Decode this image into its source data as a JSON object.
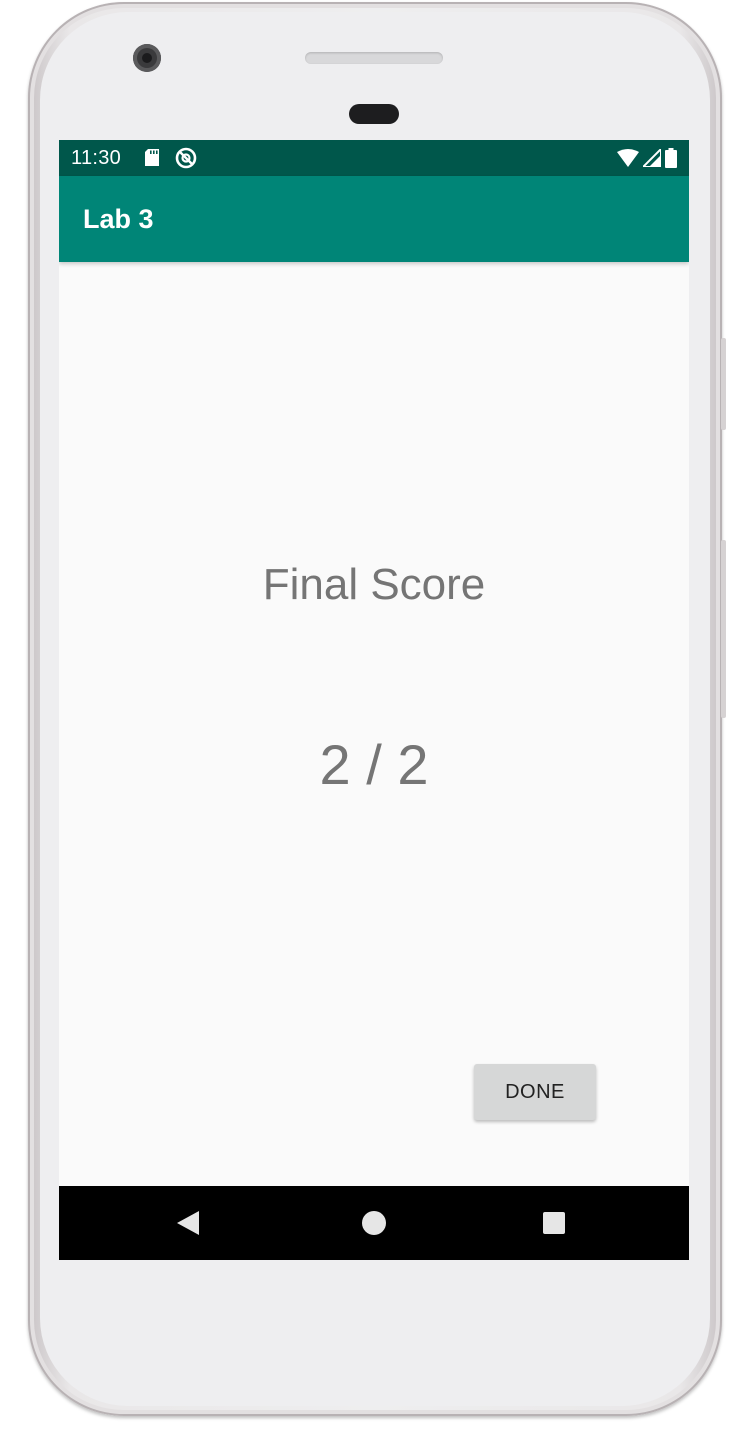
{
  "status_bar": {
    "time": "11:30",
    "icons_left": [
      "sd-card-icon",
      "sync-icon"
    ],
    "icons_right": [
      "wifi-icon",
      "cell-signal-icon",
      "battery-icon"
    ],
    "background_color": "#00574b"
  },
  "app_bar": {
    "title": "Lab 3",
    "background_color": "#008577"
  },
  "main": {
    "final_score_label": "Final Score",
    "score_value": "2 / 2",
    "done_button_label": "DONE"
  },
  "nav_bar": {
    "buttons": [
      "back-icon",
      "home-icon",
      "recents-icon"
    ]
  }
}
